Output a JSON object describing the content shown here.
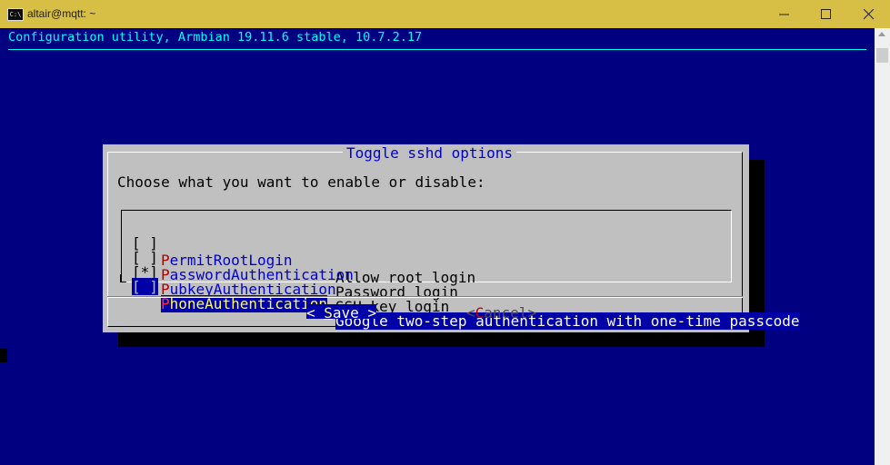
{
  "window": {
    "title": "altair@mqtt: ~",
    "icon": "terminal-icon"
  },
  "terminal": {
    "backtitle": "Configuration utility, Armbian 19.11.6 stable, 10.7.2.17"
  },
  "dialog": {
    "title": "Toggle sshd options",
    "prompt": "Choose what you want to enable or disable:",
    "items": [
      {
        "check": "[ ]",
        "tag_hot": "P",
        "tag_rest": "ermitRootLogin",
        "desc": "Allow root login",
        "checked": false,
        "selected": false
      },
      {
        "check": "[ ]",
        "tag_hot": "P",
        "tag_rest": "asswordAuthentication",
        "desc": "Password login",
        "checked": false,
        "selected": false
      },
      {
        "check": "[*]",
        "tag_hot": "P",
        "tag_rest": "ubkeyAuthentication",
        "desc": "SSH key login",
        "checked": true,
        "selected": false
      },
      {
        "check": "[ ]",
        "tag_hot": "P",
        "tag_rest": "honeAuthentication",
        "desc": "Google two-step authentication with one-time passcode",
        "checked": false,
        "selected": true
      }
    ],
    "buttons": {
      "save": {
        "pre": "< ",
        "hot": "S",
        "rest": "ave",
        "post": " >"
      },
      "cancel": {
        "pre": "<",
        "hot": "C",
        "rest": "ancel",
        "post": ">"
      }
    }
  },
  "colors": {
    "terminal_bg": "#000080",
    "backtitle": "#00ffff",
    "dialog_bg": "#c0c0c0",
    "selection_bg": "#0000a8",
    "titlebar_bg": "#d7bf45"
  }
}
